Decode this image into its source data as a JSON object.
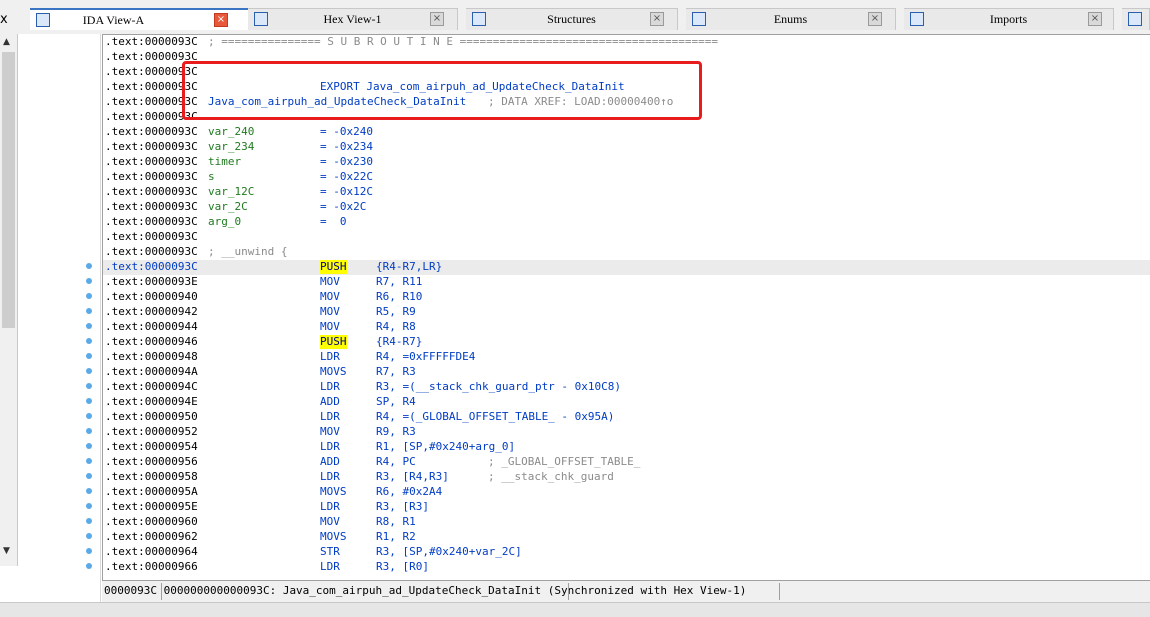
{
  "tabs": [
    {
      "label": "IDA View-A",
      "active": true
    },
    {
      "label": "Hex View-1",
      "active": false
    },
    {
      "label": "Structures",
      "active": false
    },
    {
      "label": "Enums",
      "active": false
    },
    {
      "label": "Imports",
      "active": false
    }
  ],
  "close_glyph": "×",
  "window_close_glyph": "x",
  "nav": {
    "up_glyph": "▲",
    "down_glyph": "▼"
  },
  "listing": {
    "segment_prefix": ".text:",
    "lines": [
      {
        "addr": "0000093C",
        "comment": "; =============== S U B R O U T I N E ======================================="
      },
      {
        "addr": "0000093C"
      },
      {
        "addr": "0000093C"
      },
      {
        "addr": "0000093C",
        "export": "EXPORT Java_com_airpuh_ad_UpdateCheck_DataInit"
      },
      {
        "addr": "0000093C",
        "fn": "Java_com_airpuh_ad_UpdateCheck_DataInit",
        "fncmt": "; DATA XREF: LOAD:00000400↑o"
      },
      {
        "addr": "0000093C"
      },
      {
        "addr": "0000093C",
        "label": "var_240",
        "eq": "= -0x240"
      },
      {
        "addr": "0000093C",
        "label": "var_234",
        "eq": "= -0x234"
      },
      {
        "addr": "0000093C",
        "label": "timer",
        "eq": "= -0x230"
      },
      {
        "addr": "0000093C",
        "label": "s",
        "eq": "= -0x22C"
      },
      {
        "addr": "0000093C",
        "label": "var_12C",
        "eq": "= -0x12C"
      },
      {
        "addr": "0000093C",
        "label": "var_2C",
        "eq": "= -0x2C"
      },
      {
        "addr": "0000093C",
        "label": "arg_0",
        "eq": "=  0"
      },
      {
        "addr": "0000093C"
      },
      {
        "addr": "0000093C",
        "comment": "; __unwind {"
      },
      {
        "addr": "0000093C",
        "mn": "PUSH",
        "hl": true,
        "ops": "{R4-R7,LR}",
        "dot": true,
        "current": true
      },
      {
        "addr": "0000093E",
        "mn": "MOV",
        "ops": "R7, R11",
        "dot": true
      },
      {
        "addr": "00000940",
        "mn": "MOV",
        "ops": "R6, R10",
        "dot": true
      },
      {
        "addr": "00000942",
        "mn": "MOV",
        "ops": "R5, R9",
        "dot": true
      },
      {
        "addr": "00000944",
        "mn": "MOV",
        "ops": "R4, R8",
        "dot": true
      },
      {
        "addr": "00000946",
        "mn": "PUSH",
        "hl": true,
        "ops": "{R4-R7}",
        "dot": true
      },
      {
        "addr": "00000948",
        "mn": "LDR",
        "ops": "R4, =0xFFFFFDE4",
        "dot": true
      },
      {
        "addr": "0000094A",
        "mn": "MOVS",
        "ops": "R7, R3",
        "dot": true
      },
      {
        "addr": "0000094C",
        "mn": "LDR",
        "ops": "R3, =(__stack_chk_guard_ptr - 0x10C8)",
        "dot": true
      },
      {
        "addr": "0000094E",
        "mn": "ADD",
        "ops": "SP, R4",
        "dot": true
      },
      {
        "addr": "00000950",
        "mn": "LDR",
        "ops": "R4, =(_GLOBAL_OFFSET_TABLE_ - 0x95A)",
        "dot": true
      },
      {
        "addr": "00000952",
        "mn": "MOV",
        "ops": "R9, R3",
        "dot": true
      },
      {
        "addr": "00000954",
        "mn": "LDR",
        "ops": "R1, [SP,#0x240+arg_0]",
        "dot": true
      },
      {
        "addr": "00000956",
        "mn": "ADD",
        "ops": "R4, PC",
        "cmt": "; _GLOBAL_OFFSET_TABLE_",
        "dot": true
      },
      {
        "addr": "00000958",
        "mn": "LDR",
        "ops": "R3, [R4,R3]",
        "cmt": "; __stack_chk_guard",
        "dot": true
      },
      {
        "addr": "0000095A",
        "mn": "MOVS",
        "ops": "R6, #0x2A4",
        "dot": true
      },
      {
        "addr": "0000095E",
        "mn": "LDR",
        "ops": "R3, [R3]",
        "dot": true
      },
      {
        "addr": "00000960",
        "mn": "MOV",
        "ops": "R8, R1",
        "dot": true
      },
      {
        "addr": "00000962",
        "mn": "MOVS",
        "ops": "R1, R2",
        "dot": true
      },
      {
        "addr": "00000964",
        "mn": "STR",
        "ops": "R3, [SP,#0x240+var_2C]",
        "dot": true
      },
      {
        "addr": "00000966",
        "mn": "LDR",
        "ops": "R3, [R0]",
        "dot": true
      }
    ]
  },
  "status": {
    "addr": "0000093C",
    "location": "000000000000093C: Java_com_airpuh_ad_UpdateCheck_DataInit",
    "sync": "(Synchronized with Hex View-1)"
  },
  "colors": {
    "accent": "#3a75c4",
    "annotation": "#e81c1c",
    "mnemonic": "#003cc4",
    "label": "#1f7a1f",
    "comment": "#8b8b8b",
    "highlight": "#ffff00"
  }
}
